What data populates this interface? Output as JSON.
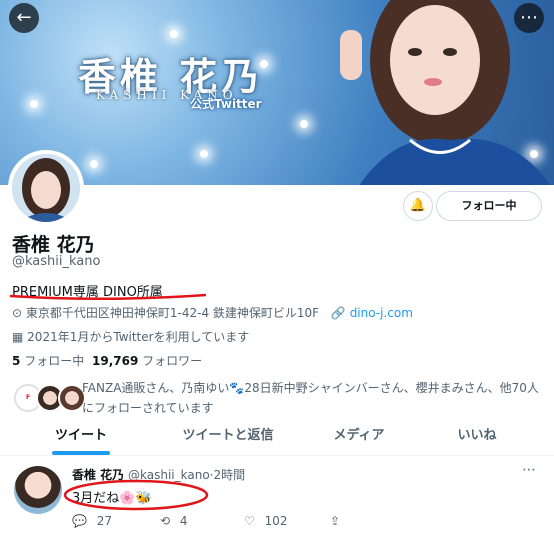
{
  "banner": {
    "title": "香椎 花乃",
    "subtitle": "KASHII KANO",
    "tag": "公式Twitter"
  },
  "profile": {
    "name": "香椎 花乃",
    "handle": "@kashii_kano",
    "bio": "PREMIUM専属 DINO所属",
    "location": "東京都千代田区神田神保町1-42-4 鉄建神保町ビル10F",
    "website": "dino-j.com",
    "joined": "2021年1月からTwitterを利用しています",
    "following_count": "5",
    "following_label": "フォロー中",
    "followers_count": "19,769",
    "followers_label": "フォロワー",
    "followed_by": "FANZA通販さん、乃南ゆい🐾28日新中野シャインバーさん、櫻井まみさん、他70人にフォローされています",
    "follow_button": "フォロー中"
  },
  "tabs": [
    "ツイート",
    "ツイートと返信",
    "メディア",
    "いいね"
  ],
  "tweet": {
    "name": "香椎 花乃",
    "handle": "@kashii_kano",
    "time": "2時間",
    "text": "3月だね🌸🐝",
    "replies": "27",
    "retweets": "4",
    "likes": "102"
  },
  "icons": {
    "back": "back-arrow-icon",
    "more": "more-icon",
    "bell": "notification-bell-icon",
    "location": "location-icon",
    "link": "link-icon",
    "calendar": "calendar-icon",
    "reply": "reply-icon",
    "retweet": "retweet-icon",
    "like": "like-icon",
    "share": "share-icon"
  },
  "colors": {
    "accent": "#1d9bf0",
    "highlight": "#e0161b"
  }
}
